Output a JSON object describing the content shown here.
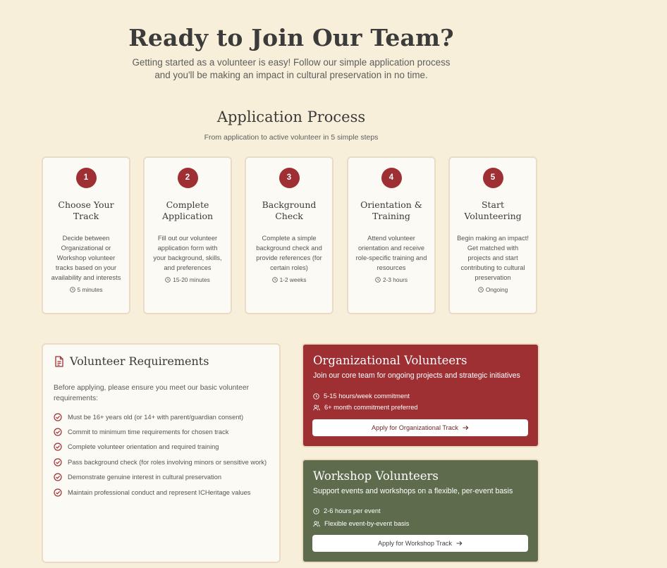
{
  "hero": {
    "title": "Ready to Join Our Team?",
    "subtitle": "Getting started as a volunteer is easy! Follow our simple application process and you'll be making an impact in cultural preservation in no time."
  },
  "process": {
    "title": "Application Process",
    "subtitle": "From application to active volunteer in 5 simple steps",
    "steps": [
      {
        "number": "1",
        "title": "Choose Your Track",
        "description": "Decide between Organizational or Workshop volunteer tracks based on your availability and interests",
        "time": "5 minutes"
      },
      {
        "number": "2",
        "title": "Complete Application",
        "description": "Fill out our volunteer application form with your background, skills, and preferences",
        "time": "15-20 minutes"
      },
      {
        "number": "3",
        "title": "Background Check",
        "description": "Complete a simple background check and provide references (for certain roles)",
        "time": "1-2 weeks"
      },
      {
        "number": "4",
        "title": "Orientation & Training",
        "description": "Attend volunteer orientation and receive role-specific training and resources",
        "time": "2-3 hours"
      },
      {
        "number": "5",
        "title": "Start Volunteering",
        "description": "Begin making an impact! Get matched with projects and start contributing to cultural preservation",
        "time": "Ongoing"
      }
    ]
  },
  "requirements": {
    "title": "Volunteer Requirements",
    "intro": "Before applying, please ensure you meet our basic volunteer requirements:",
    "items": [
      "Must be 16+ years old (or 14+ with parent/guardian consent)",
      "Commit to minimum time requirements for chosen track",
      "Complete volunteer orientation and required training",
      "Pass background check (for roles involving minors or sensitive work)",
      "Demonstrate genuine interest in cultural preservation",
      "Maintain professional conduct and represent ICHeritage values"
    ]
  },
  "tracks": {
    "organizational": {
      "title": "Organizational Volunteers",
      "subtitle": "Join our core team for ongoing projects and strategic initiatives",
      "commitment": "5-15 hours/week commitment",
      "duration": "6+ month commitment preferred",
      "button": "Apply for Organizational Track"
    },
    "workshop": {
      "title": "Workshop Volunteers",
      "subtitle": "Support events and workshops on a flexible, per-event basis",
      "commitment": "2-6 hours per event",
      "duration": "Flexible event-by-event basis",
      "button": "Apply for Workshop Track"
    }
  },
  "colors": {
    "background": "#f7efd9",
    "accent_red": "#9e2f33",
    "accent_green": "#5e6b4c",
    "card": "#fcfaf5",
    "card_border": "#eadcc4"
  },
  "icons": {
    "time": "clock-icon",
    "people": "users-icon",
    "document": "document-icon",
    "check": "check-circle-icon",
    "arrow": "arrow-right-icon"
  }
}
